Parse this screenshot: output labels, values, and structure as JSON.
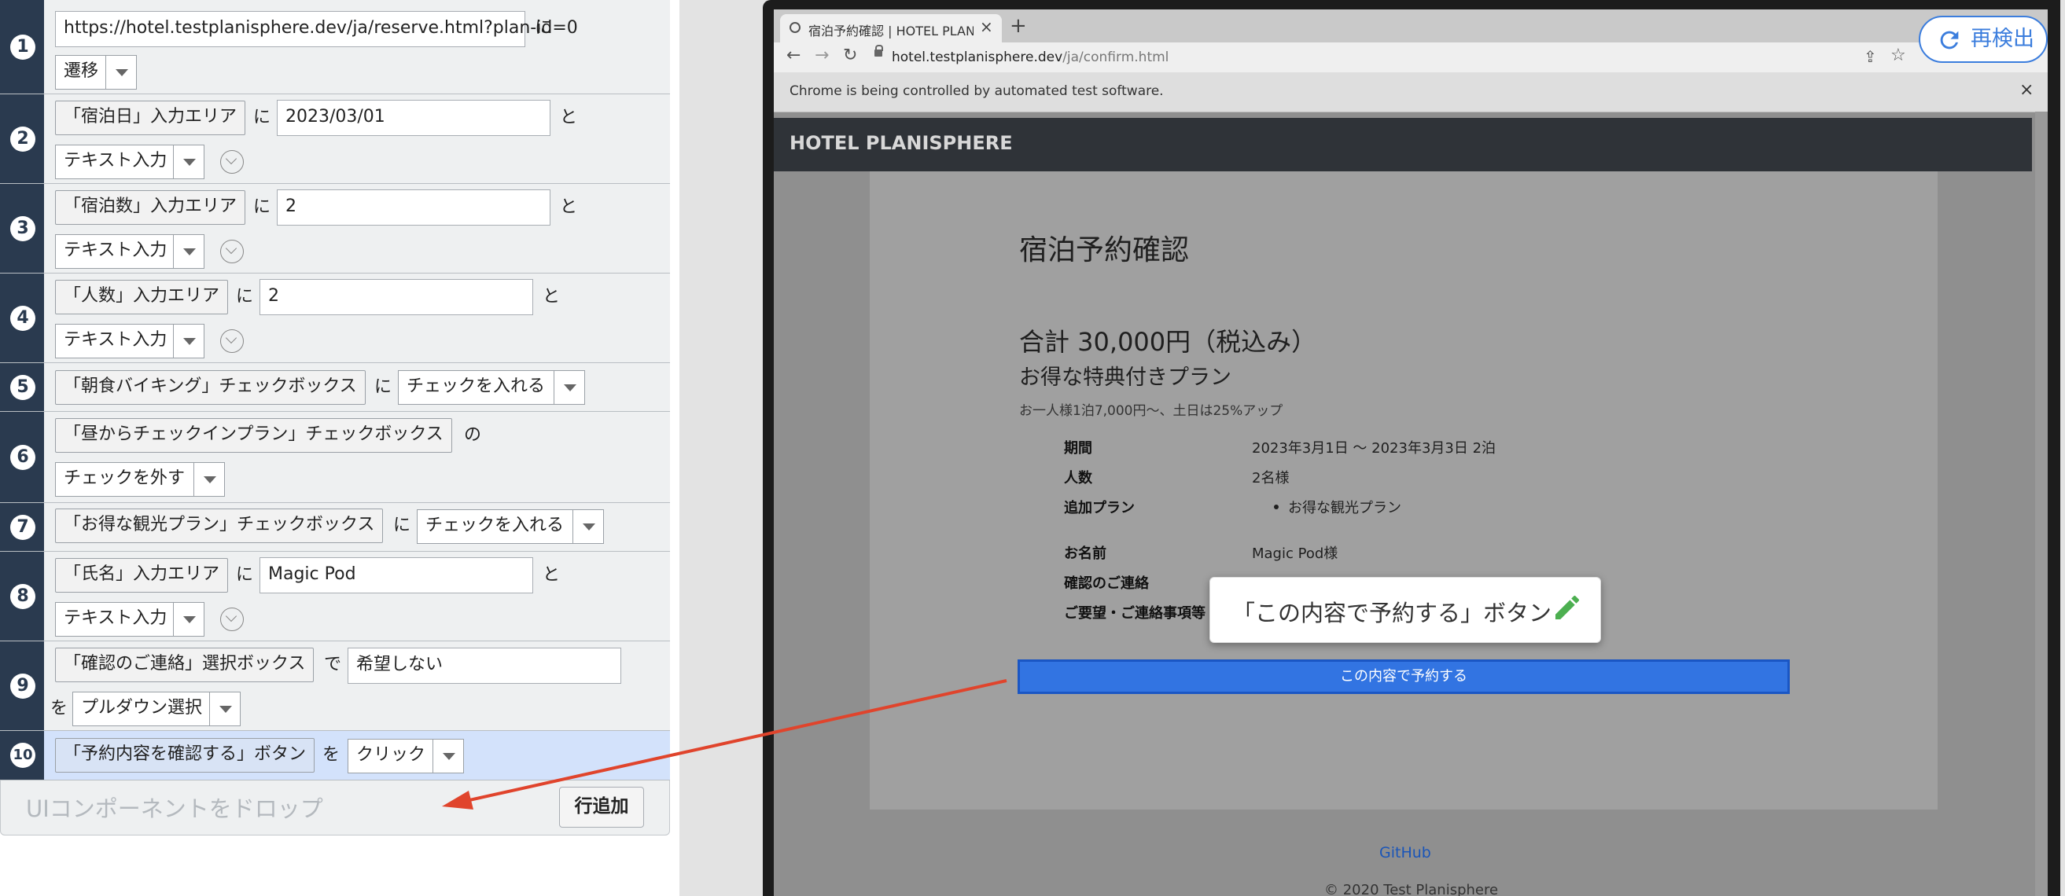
{
  "steps": [
    {
      "num": "1",
      "url": "https://hotel.testplanisphere.dev/ja/reserve.html?plan-id=0",
      "conn": "に",
      "action": "遷移"
    },
    {
      "num": "2",
      "target": "「宿泊日」入力エリア",
      "conn1": "に",
      "value": "2023/03/01",
      "conn2": "と",
      "action": "テキスト入力"
    },
    {
      "num": "3",
      "target": "「宿泊数」入力エリア",
      "conn1": "に",
      "value": "2",
      "conn2": "と",
      "action": "テキスト入力"
    },
    {
      "num": "4",
      "target": "「人数」入力エリア",
      "conn1": "に",
      "value": "2",
      "conn2": "と",
      "action": "テキスト入力"
    },
    {
      "num": "5",
      "target": "「朝食バイキング」チェックボックス",
      "conn1": "に",
      "action": "チェックを入れる"
    },
    {
      "num": "6",
      "target": "「昼からチェックインプラン」チェックボックス",
      "conn1": "の",
      "action": "チェックを外す"
    },
    {
      "num": "7",
      "target": "「お得な観光プラン」チェックボックス",
      "conn1": "に",
      "action": "チェックを入れる"
    },
    {
      "num": "8",
      "target": "「氏名」入力エリア",
      "conn1": "に",
      "value": "Magic Pod",
      "conn2": "と",
      "action": "テキスト入力"
    },
    {
      "num": "9",
      "target": "「確認のご連絡」選択ボックス",
      "conn1": "で",
      "value": "希望しない",
      "conn2": "を",
      "action": "プルダウン選択"
    },
    {
      "num": "10",
      "target": "「予約内容を確認する」ボタン",
      "conn1": "を",
      "action": "クリック"
    }
  ],
  "drop_placeholder": "UIコンポーネントをドロップ",
  "add_row_label": "行追加",
  "redetect_label": "再検出",
  "browser": {
    "tab_title": "宿泊予約確認 | HOTEL PLANISPHERE",
    "tab_close": "×",
    "new_tab": "+",
    "url_host": "hotel.testplanisphere.dev",
    "url_path": "/ja/confirm.html",
    "automation_notice": "Chrome is being controlled by automated test software.",
    "infobar_close": "×"
  },
  "page": {
    "brand": "HOTEL PLANISPHERE",
    "heading": "宿泊予約確認",
    "total": "合計 30,000円（税込み）",
    "plan_name": "お得な特典付きプラン",
    "plan_desc": "お一人様1泊7,000円〜、土日は25%アップ",
    "details": [
      {
        "label": "期間",
        "value": "2023年3月1日 〜 2023年3月3日 2泊"
      },
      {
        "label": "人数",
        "value": "2名様"
      },
      {
        "label": "追加プラン",
        "value": "お得な観光プラン"
      },
      {
        "label": "お名前",
        "value": "Magic Pod様"
      },
      {
        "label": "確認のご連絡",
        "value": ""
      },
      {
        "label": "ご要望・ご連絡事項等",
        "value": ""
      }
    ],
    "confirm_button": "この内容で予約する",
    "footer_link": "GitHub",
    "copyright": "© 2020 Test Planisphere"
  },
  "tooltip": {
    "text": "「この内容で予約する」ボタン"
  },
  "colors": {
    "step_number_bg": "#2a3a4f",
    "selected_row": "#d3e2fb",
    "confirm_button": "#3274e2",
    "arrow": "#e0442c",
    "pencil": "#4caf50",
    "redetect": "#3b7ddd"
  },
  "icons": [
    "globe-icon",
    "close-icon",
    "plus-icon",
    "back-icon",
    "forward-icon",
    "reload-icon",
    "lock-icon",
    "share-icon",
    "star-icon",
    "pencil-icon",
    "refresh-icon",
    "chevron-down-icon"
  ]
}
